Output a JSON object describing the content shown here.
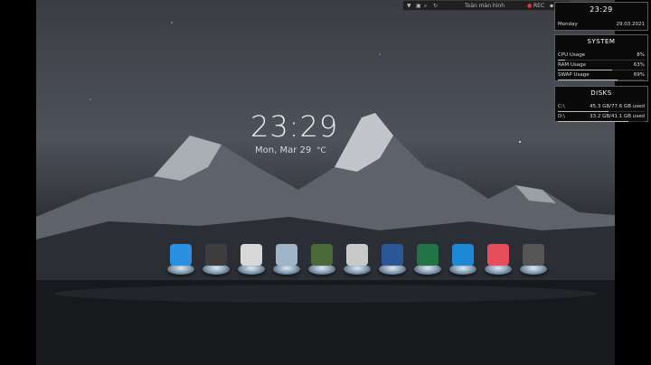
{
  "desktop": {
    "clock": {
      "time": "23:29",
      "date": "Mon, Mar 29",
      "temp_unit": "°C"
    },
    "dock": [
      {
        "name": "windows-icon",
        "color": "#2b8fe0"
      },
      {
        "name": "computer-icon",
        "color": "#3d3d3d"
      },
      {
        "name": "clock-icon",
        "color": "#d7d7d7"
      },
      {
        "name": "recycle-bin-icon",
        "color": "#9fb4c8"
      },
      {
        "name": "media-app-icon",
        "color": "#4a6a3a"
      },
      {
        "name": "safari-globe-icon",
        "color": "#c9c9c9"
      },
      {
        "name": "word-icon",
        "color": "#2b5797"
      },
      {
        "name": "excel-icon",
        "color": "#217346"
      },
      {
        "name": "monitor-icon",
        "color": "#1e88d8"
      },
      {
        "name": "apple-icon",
        "color": "#e84e5a"
      },
      {
        "name": "power-icon",
        "color": "#555555"
      }
    ]
  },
  "toolbar": {
    "title": "Toàn màn hình",
    "rec_label": "REC",
    "close": "✕",
    "rec_color": "#e53935"
  },
  "widgets": {
    "time": {
      "time": "23:29",
      "day": "Monday",
      "date": "29.03.2021"
    },
    "system": {
      "title": "SYSTEM",
      "rows": [
        {
          "label": "CPU Usage",
          "value": "8%",
          "pct": 8
        },
        {
          "label": "RAM Usage",
          "value": "63%",
          "pct": 63
        },
        {
          "label": "SWAP Usage",
          "value": "69%",
          "pct": 69
        }
      ]
    },
    "disks": {
      "title": "DISKS",
      "rows": [
        {
          "label": "C:\\",
          "value": "45.3 GB/77.6 GB used",
          "pct": 58
        },
        {
          "label": "D:\\",
          "value": "33.2 GB/41.1 GB used",
          "pct": 81
        }
      ]
    }
  }
}
